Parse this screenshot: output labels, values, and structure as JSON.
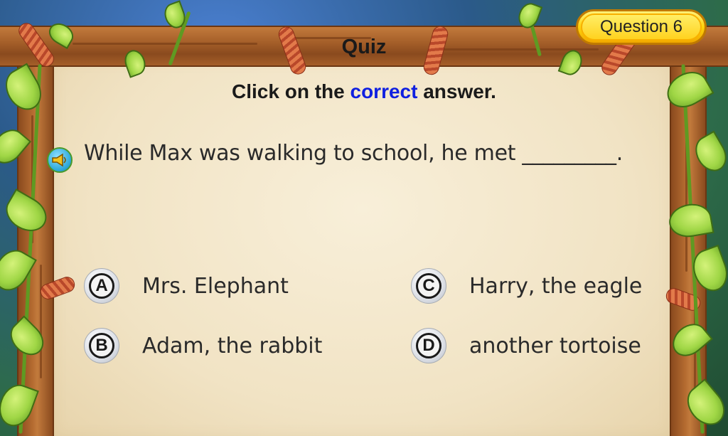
{
  "header": {
    "title": "Quiz",
    "question_badge": "Question 6"
  },
  "instruction": {
    "before": "Click on the ",
    "highlight": "correct",
    "after": " answer."
  },
  "question": {
    "text": "While Max was walking to school, he met _________.",
    "audio_icon": "speaker-icon"
  },
  "options": [
    {
      "letter": "A",
      "text": "Mrs. Elephant"
    },
    {
      "letter": "B",
      "text": "Adam, the rabbit"
    },
    {
      "letter": "C",
      "text": "Harry, the eagle"
    },
    {
      "letter": "D",
      "text": "another tortoise"
    }
  ],
  "colors": {
    "highlight": "#1020e0",
    "badge": "#ffd20a",
    "wood": "#a55f29",
    "leaf": "#9fd645",
    "parchment": "#f1e3c4"
  }
}
